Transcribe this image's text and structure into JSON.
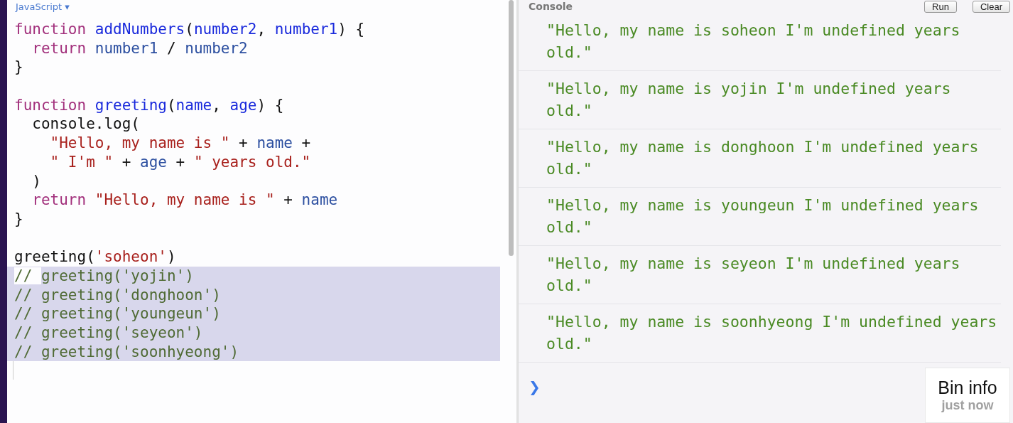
{
  "editor": {
    "language_menu": "JavaScript ▾",
    "lines": [
      {
        "selected": false,
        "tokens": [
          {
            "kind": "keyword",
            "text": "function "
          },
          {
            "kind": "def",
            "text": "addNumbers"
          },
          {
            "kind": "plain",
            "text": "("
          },
          {
            "kind": "def",
            "text": "number2"
          },
          {
            "kind": "plain",
            "text": ", "
          },
          {
            "kind": "def",
            "text": "number1"
          },
          {
            "kind": "plain",
            "text": ") {"
          }
        ]
      },
      {
        "selected": false,
        "tokens": [
          {
            "kind": "keyword",
            "text": "  return "
          },
          {
            "kind": "variable",
            "text": "number1"
          },
          {
            "kind": "plain",
            "text": " / "
          },
          {
            "kind": "variable",
            "text": "number2"
          }
        ]
      },
      {
        "selected": false,
        "tokens": [
          {
            "kind": "plain",
            "text": "}"
          }
        ]
      },
      {
        "selected": false
      },
      {
        "selected": false,
        "tokens": [
          {
            "kind": "keyword",
            "text": "function "
          },
          {
            "kind": "def",
            "text": "greeting"
          },
          {
            "kind": "plain",
            "text": "("
          },
          {
            "kind": "def",
            "text": "name"
          },
          {
            "kind": "plain",
            "text": ", "
          },
          {
            "kind": "def",
            "text": "age"
          },
          {
            "kind": "plain",
            "text": ") {"
          }
        ]
      },
      {
        "selected": false,
        "tokens": [
          {
            "kind": "plain",
            "text": "  console.log("
          }
        ]
      },
      {
        "selected": false,
        "tokens": [
          {
            "kind": "string",
            "text": "    \"Hello, my name is \""
          },
          {
            "kind": "plain",
            "text": " + "
          },
          {
            "kind": "variable",
            "text": "name"
          },
          {
            "kind": "plain",
            "text": " +"
          }
        ]
      },
      {
        "selected": false,
        "tokens": [
          {
            "kind": "string",
            "text": "    \" I'm \""
          },
          {
            "kind": "plain",
            "text": " + "
          },
          {
            "kind": "variable",
            "text": "age"
          },
          {
            "kind": "plain",
            "text": " + "
          },
          {
            "kind": "string",
            "text": "\" years old.\""
          }
        ]
      },
      {
        "selected": false,
        "tokens": [
          {
            "kind": "plain",
            "text": "  )"
          }
        ]
      },
      {
        "selected": false,
        "tokens": [
          {
            "kind": "keyword",
            "text": "  return "
          },
          {
            "kind": "string",
            "text": "\"Hello, my name is \""
          },
          {
            "kind": "plain",
            "text": " + "
          },
          {
            "kind": "variable",
            "text": "name"
          }
        ]
      },
      {
        "selected": false,
        "tokens": [
          {
            "kind": "plain",
            "text": "}"
          }
        ]
      },
      {
        "selected": false
      },
      {
        "selected": false,
        "tokens": [
          {
            "kind": "plain",
            "text": "greeting("
          },
          {
            "kind": "string",
            "text": "'soheon'"
          },
          {
            "kind": "plain",
            "text": ")"
          }
        ]
      },
      {
        "selected": true,
        "tokens": [
          {
            "kind": "comment",
            "text": "// ",
            "selected": false
          },
          {
            "kind": "comment",
            "text": "greeting('yojin')",
            "selected": true
          }
        ]
      },
      {
        "selected": true,
        "tokens": [
          {
            "kind": "comment",
            "text": "// greeting('donghoon')",
            "selected": true
          }
        ]
      },
      {
        "selected": true,
        "tokens": [
          {
            "kind": "comment",
            "text": "// greeting('youngeun')",
            "selected": true
          }
        ]
      },
      {
        "selected": true,
        "tokens": [
          {
            "kind": "comment",
            "text": "// greeting('seyeon')",
            "selected": true
          }
        ]
      },
      {
        "selected": true,
        "tokens": [
          {
            "kind": "comment",
            "text": "// greeting('soonhyeong')",
            "selected": true
          }
        ]
      }
    ]
  },
  "console": {
    "title": "Console",
    "buttons": [
      "Run",
      "Clear"
    ],
    "messages": [
      "\"Hello, my name is soheon I'm undefined years old.\"",
      "\"Hello, my name is yojin I'm undefined years old.\"",
      "\"Hello, my name is donghoon I'm undefined years old.\"",
      "\"Hello, my name is youngeun I'm undefined years old.\"",
      "\"Hello, my name is seyeon I'm undefined years old.\"",
      "\"Hello, my name is soonhyeong I'm undefined years old.\""
    ],
    "prompt": "❯"
  },
  "bin_info": {
    "title": "Bin info",
    "time": "just now"
  }
}
